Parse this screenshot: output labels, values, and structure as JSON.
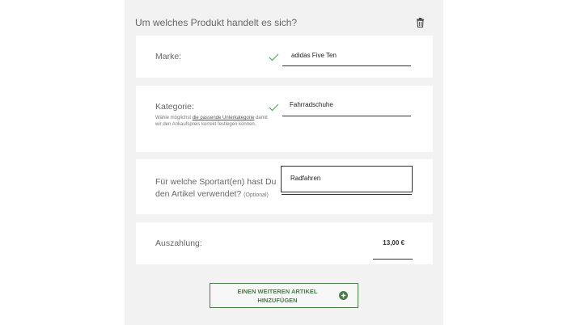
{
  "section": {
    "title": "Um welches Produkt handelt es sich?"
  },
  "brand": {
    "label": "Marke:",
    "value": "adidas Five Ten",
    "status": "valid"
  },
  "category": {
    "label": "Kategorie:",
    "value": "Fahrradschuhe",
    "status": "valid",
    "hint_before": "Wähle möglichst ",
    "hint_link": "die passende Unterkategorie",
    "hint_after": " damit wir den Ankaufspreis korrekt festlegen können."
  },
  "sport": {
    "label": "Für welche Sportart(en) hast Du den Artikel verwendet?",
    "optional": "(Optional)",
    "value": "Radfahren"
  },
  "payout": {
    "label": "Auszahlung:",
    "amount": "13,00 €"
  },
  "add_button": {
    "label": "EINEN WEITEREN ARTIKEL HINZUFÜGEN"
  },
  "colors": {
    "accent": "#4a7c4a",
    "check": "#4caf50",
    "panel": "#f2f2f2"
  },
  "icons": {
    "delete": "trash-icon",
    "valid": "checkmark-icon",
    "add": "plus-circle-icon"
  }
}
